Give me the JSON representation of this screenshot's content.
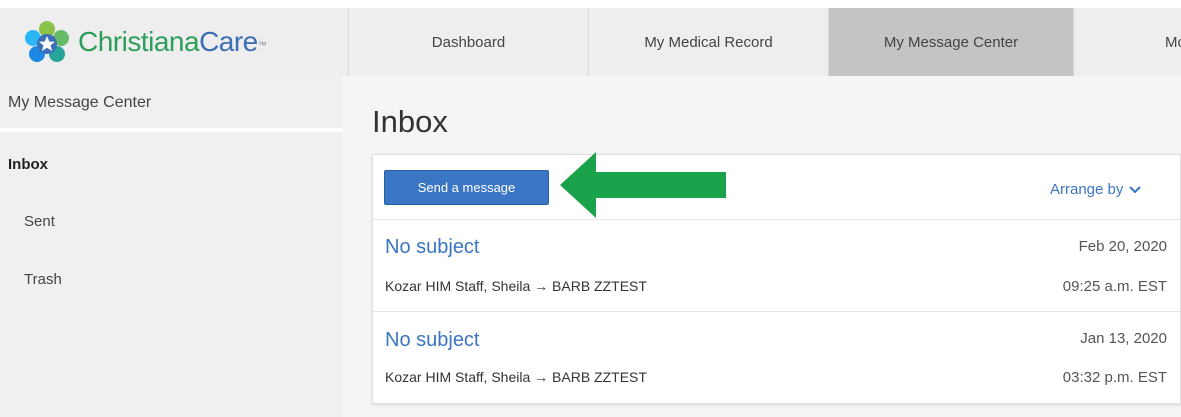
{
  "brand": {
    "name_part1": "Christiana",
    "name_part2": "Care",
    "trademark": "™"
  },
  "nav": {
    "tabs": [
      {
        "label": "Dashboard"
      },
      {
        "label": "My Medical Record"
      },
      {
        "label": "My Message Center",
        "active": true
      },
      {
        "label": "Mc"
      }
    ]
  },
  "sidebar": {
    "title": "My Message Center",
    "items": [
      {
        "label": "Inbox",
        "active": true
      },
      {
        "label": "Sent"
      },
      {
        "label": "Trash"
      }
    ]
  },
  "main": {
    "title": "Inbox",
    "send_button": "Send a message",
    "arrange_by": "Arrange by",
    "messages": [
      {
        "subject": "No subject",
        "participants": "Kozar HIM Staff, Sheila → BARB ZZTEST",
        "date": "Feb 20, 2020",
        "time": "09:25 a.m. EST"
      },
      {
        "subject": "No subject",
        "participants": "Kozar HIM Staff, Sheila → BARB ZZTEST",
        "date": "Jan 13, 2020",
        "time": "03:32 p.m. EST"
      }
    ]
  },
  "colors": {
    "accent": "#3b76c4",
    "arrow": "#1aa34a",
    "active_tab": "#c4c4c4"
  },
  "icons": {
    "arrange": "chevron-down-icon",
    "annotation": "green-arrow-left"
  }
}
